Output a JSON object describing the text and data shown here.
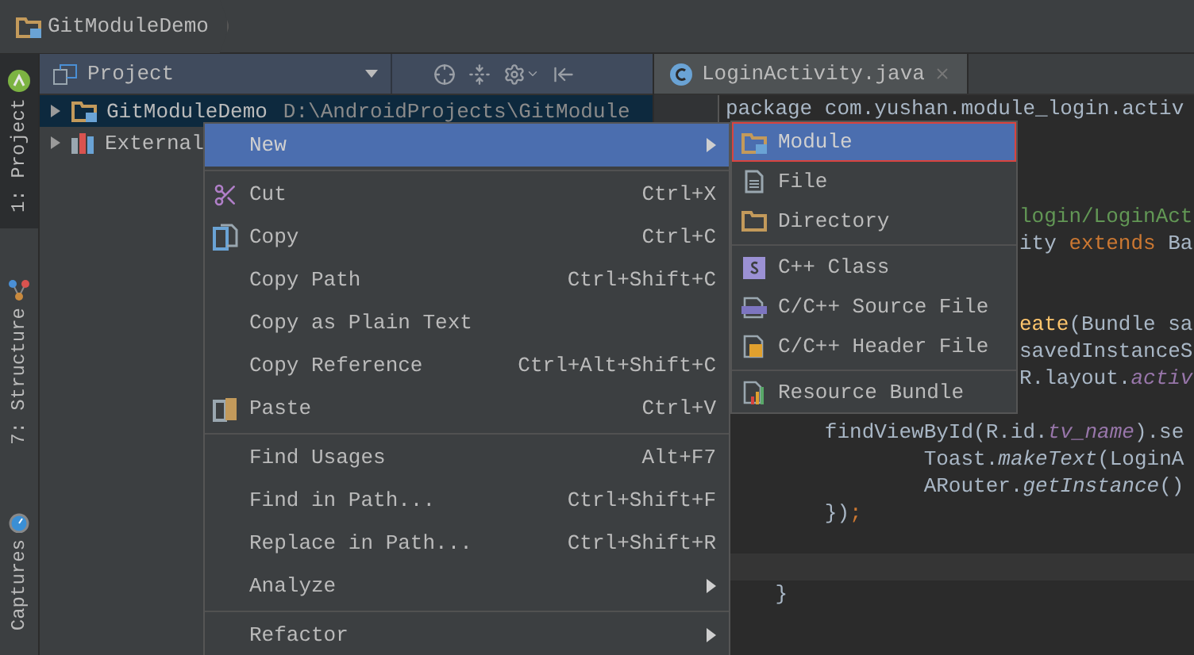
{
  "breadcrumb": {
    "label": "GitModuleDemo"
  },
  "tool_window_tabs": [
    {
      "label": "1: Project",
      "selected": true
    },
    {
      "label": "7: Structure",
      "selected": false
    },
    {
      "label": "Captures",
      "selected": false
    }
  ],
  "project_panel": {
    "view": "Project",
    "tree": [
      {
        "name": "GitModuleDemo",
        "path": "D:\\AndroidProjects\\GitModule",
        "selected": true,
        "expanded": false
      },
      {
        "name": "External",
        "selected": false,
        "expanded": false
      }
    ]
  },
  "editor": {
    "tabs": [
      {
        "label": "LoginActivity.java",
        "selected": true
      }
    ],
    "lines": [
      {
        "kind": "full",
        "segments": [
          {
            "text": "package com.yushan.module_login.activ",
            "kind": "plain"
          }
        ]
      },
      {
        "kind": "blank"
      },
      {
        "kind": "blank"
      },
      {
        "kind": "blank"
      },
      {
        "kind": "partial",
        "segments": [
          {
            "text": "login/LoginAct",
            "kind": "comment"
          }
        ]
      },
      {
        "kind": "partial",
        "segments": [
          {
            "text": "ity ",
            "kind": "plain"
          },
          {
            "text": "extends",
            "kind": "keyword"
          },
          {
            "text": " Ba",
            "kind": "plain"
          }
        ]
      },
      {
        "kind": "blank"
      },
      {
        "kind": "blank"
      },
      {
        "kind": "partial",
        "segments": [
          {
            "text": "eate",
            "kind": "method"
          },
          {
            "text": "(Bundle sa",
            "kind": "plain"
          }
        ]
      },
      {
        "kind": "partial",
        "segments": [
          {
            "text": "savedInstanceS",
            "kind": "plain"
          }
        ]
      },
      {
        "kind": "partial",
        "segments": [
          {
            "text": "R.layout.",
            "kind": "plain"
          },
          {
            "text": "activ",
            "kind": "field"
          }
        ]
      },
      {
        "kind": "blank"
      },
      {
        "kind": "full",
        "segments": [
          {
            "text": "        findViewById(R.id.",
            "kind": "plain"
          },
          {
            "text": "tv_name",
            "kind": "field"
          },
          {
            "text": ").se",
            "kind": "plain"
          }
        ]
      },
      {
        "kind": "full",
        "segments": [
          {
            "text": "                Toast.",
            "kind": "plain"
          },
          {
            "text": "makeText",
            "kind": "static"
          },
          {
            "text": "(LoginA",
            "kind": "plain"
          }
        ]
      },
      {
        "kind": "full",
        "segments": [
          {
            "text": "                ARouter.",
            "kind": "plain"
          },
          {
            "text": "getInstance",
            "kind": "static"
          },
          {
            "text": "()",
            "kind": "plain"
          }
        ]
      },
      {
        "kind": "full",
        "segments": [
          {
            "text": "        })",
            "kind": "plain"
          },
          {
            "text": ";",
            "kind": "keyword"
          }
        ]
      },
      {
        "kind": "blank"
      },
      {
        "kind": "current"
      },
      {
        "kind": "full",
        "segments": [
          {
            "text": "    }",
            "kind": "plain"
          }
        ]
      }
    ]
  },
  "context_menu": {
    "items": [
      {
        "kind": "item",
        "label": "New",
        "selected": true,
        "submenu": true
      },
      {
        "kind": "separator"
      },
      {
        "kind": "cut",
        "label": "Cut",
        "shortcut": "Ctrl+X",
        "selected": false,
        "submenu": false
      },
      {
        "kind": "copy",
        "label": "Copy",
        "shortcut": "Ctrl+C",
        "selected": false,
        "submenu": false
      },
      {
        "kind": "item",
        "label": "Copy Path",
        "shortcut": "Ctrl+Shift+C",
        "selected": false,
        "submenu": false
      },
      {
        "kind": "item",
        "label": "Copy as Plain Text",
        "selected": false,
        "submenu": false
      },
      {
        "kind": "item",
        "label": "Copy Reference",
        "shortcut": "Ctrl+Alt+Shift+C",
        "selected": false,
        "submenu": false
      },
      {
        "kind": "paste",
        "label": "Paste",
        "shortcut": "Ctrl+V",
        "selected": false,
        "submenu": false
      },
      {
        "kind": "separator"
      },
      {
        "kind": "item",
        "label": "Find Usages",
        "shortcut": "Alt+F7",
        "selected": false,
        "submenu": false
      },
      {
        "kind": "item",
        "label": "Find in Path...",
        "shortcut": "Ctrl+Shift+F",
        "selected": false,
        "submenu": false
      },
      {
        "kind": "item",
        "label": "Replace in Path...",
        "shortcut": "Ctrl+Shift+R",
        "selected": false,
        "submenu": false
      },
      {
        "kind": "item",
        "label": "Analyze",
        "selected": false,
        "submenu": true
      },
      {
        "kind": "separator"
      },
      {
        "kind": "item",
        "label": "Refactor",
        "selected": false,
        "submenu": true
      }
    ]
  },
  "submenu": {
    "items": [
      {
        "kind": "module",
        "label": "Module",
        "selected": true
      },
      {
        "kind": "file",
        "label": "File",
        "selected": false
      },
      {
        "kind": "directory",
        "label": "Directory",
        "selected": false
      },
      {
        "kind": "separator"
      },
      {
        "kind": "class",
        "label": "C++ Class",
        "selected": false
      },
      {
        "kind": "source",
        "label": "C/C++ Source File",
        "selected": false
      },
      {
        "kind": "header",
        "label": "C/C++ Header File",
        "selected": false
      },
      {
        "kind": "separator"
      },
      {
        "kind": "bundle",
        "label": "Resource Bundle",
        "selected": false
      }
    ]
  }
}
